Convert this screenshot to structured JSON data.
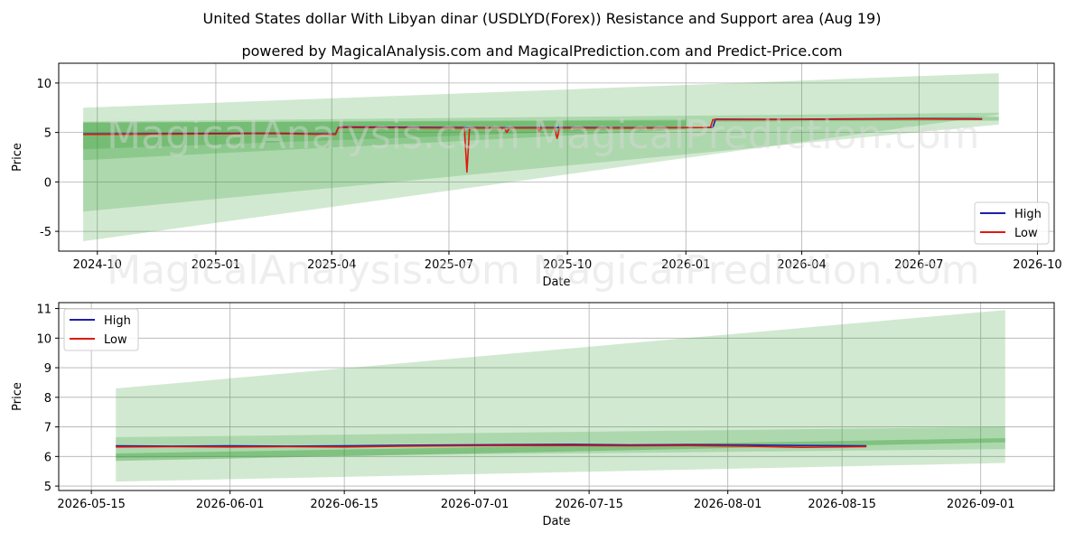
{
  "figure": {
    "title": "United States dollar With Libyan dinar (USDLYD(Forex)) Resistance and Support area (Aug 19)",
    "subtitle": "powered by MagicalAnalysis.com and MagicalPrediction.com and Predict-Price.com",
    "watermarks": [
      "MagicalAnalysis.com",
      "MagicalPrediction.com"
    ],
    "colors": {
      "high": "#1f1fa8",
      "low": "#e0190f",
      "band": "#2e9b2e",
      "grid": "#b0b0b0"
    }
  },
  "chart_data": [
    {
      "type": "line",
      "xlabel": "Date",
      "ylabel": "Price",
      "xlim": [
        "2024-09-01",
        "2026-10-14"
      ],
      "ylim": [
        -7,
        12
      ],
      "xticks": [
        "2024-10",
        "2025-01",
        "2025-04",
        "2025-07",
        "2025-10",
        "2026-01",
        "2026-04",
        "2026-07",
        "2026-10"
      ],
      "xtick_dates": [
        "2024-10-01",
        "2025-01-01",
        "2025-04-01",
        "2025-07-01",
        "2025-10-01",
        "2026-01-01",
        "2026-04-01",
        "2026-07-01",
        "2026-10-01"
      ],
      "yticks": [
        -5,
        0,
        5,
        10
      ],
      "legend": {
        "position": "lower-right",
        "entries": [
          "High",
          "Low"
        ]
      },
      "grid": true,
      "series": [
        {
          "name": "High",
          "x": [
            "2024-09-20",
            "2024-12-01",
            "2025-02-15",
            "2025-03-20",
            "2025-04-04",
            "2025-04-06",
            "2025-04-10",
            "2025-06-01",
            "2025-08-01",
            "2025-10-01",
            "2025-12-01",
            "2026-01-15",
            "2026-01-22",
            "2026-01-24",
            "2026-03-01",
            "2026-05-01",
            "2026-07-01",
            "2026-08-19"
          ],
          "values": [
            4.85,
            4.88,
            4.92,
            4.86,
            4.85,
            5.5,
            5.55,
            5.52,
            5.48,
            5.5,
            5.48,
            5.5,
            5.52,
            6.35,
            6.33,
            6.36,
            6.4,
            6.37
          ]
        },
        {
          "name": "Low",
          "x": [
            "2024-09-20",
            "2024-12-01",
            "2025-02-15",
            "2025-03-20",
            "2025-04-04",
            "2025-04-06",
            "2025-04-10",
            "2025-06-01",
            "2025-07-13",
            "2025-07-15",
            "2025-07-17",
            "2025-08-13",
            "2025-08-15",
            "2025-08-17",
            "2025-09-08",
            "2025-09-09",
            "2025-09-10",
            "2025-09-21",
            "2025-09-23",
            "2025-09-25",
            "2025-12-01",
            "2026-01-20",
            "2026-01-22",
            "2026-03-01",
            "2026-05-01",
            "2026-07-01",
            "2026-08-19"
          ],
          "values": [
            4.8,
            4.84,
            4.88,
            4.82,
            4.8,
            5.45,
            5.5,
            5.47,
            5.45,
            1.0,
            5.45,
            5.45,
            5.0,
            5.45,
            5.45,
            5.05,
            5.45,
            5.45,
            4.4,
            5.45,
            5.45,
            5.5,
            6.3,
            6.3,
            6.33,
            6.36,
            6.33
          ]
        }
      ],
      "bands": [
        {
          "x": [
            "2024-09-20",
            "2026-09-01"
          ],
          "upper": [
            7.5,
            11.0
          ],
          "lower": [
            -6.0,
            6.8
          ],
          "opacity": 0.22
        },
        {
          "x": [
            "2024-09-20",
            "2026-09-01"
          ],
          "upper": [
            6.1,
            7.0
          ],
          "lower": [
            -3.0,
            5.8
          ],
          "opacity": 0.22
        },
        {
          "x": [
            "2024-09-20",
            "2026-01-01"
          ],
          "upper": [
            6.0,
            6.2
          ],
          "lower": [
            2.2,
            5.3
          ],
          "opacity": 0.25
        },
        {
          "x": [
            "2024-09-20",
            "2026-01-01"
          ],
          "upper": [
            6.0,
            6.3
          ],
          "lower": [
            3.3,
            5.5
          ],
          "opacity": 0.25
        },
        {
          "x": [
            "2026-01-22",
            "2026-09-01"
          ],
          "upper": [
            6.3,
            6.6
          ],
          "lower": [
            6.1,
            6.2
          ],
          "opacity": 0.3
        }
      ]
    },
    {
      "type": "line",
      "xlabel": "Date",
      "ylabel": "Price",
      "xlim": [
        "2026-05-11",
        "2026-09-10"
      ],
      "ylim": [
        4.85,
        11.2
      ],
      "xticks": [
        "2026-05-15",
        "2026-06-01",
        "2026-06-15",
        "2026-07-01",
        "2026-07-15",
        "2026-08-01",
        "2026-08-15",
        "2026-09-01"
      ],
      "yticks": [
        5,
        6,
        7,
        8,
        9,
        10,
        11
      ],
      "legend": {
        "position": "upper-left",
        "entries": [
          "High",
          "Low"
        ]
      },
      "grid": true,
      "series": [
        {
          "name": "High",
          "x": [
            "2026-05-18",
            "2026-05-25",
            "2026-06-01",
            "2026-06-08",
            "2026-06-15",
            "2026-06-22",
            "2026-06-29",
            "2026-07-06",
            "2026-07-13",
            "2026-07-20",
            "2026-07-27",
            "2026-08-03",
            "2026-08-10",
            "2026-08-18"
          ],
          "values": [
            6.36,
            6.35,
            6.36,
            6.35,
            6.36,
            6.38,
            6.39,
            6.4,
            6.41,
            6.39,
            6.4,
            6.39,
            6.37,
            6.36
          ]
        },
        {
          "name": "Low",
          "x": [
            "2026-05-18",
            "2026-05-25",
            "2026-06-01",
            "2026-06-08",
            "2026-06-15",
            "2026-06-22",
            "2026-06-29",
            "2026-07-06",
            "2026-07-13",
            "2026-07-20",
            "2026-07-27",
            "2026-08-03",
            "2026-08-10",
            "2026-08-18"
          ],
          "values": [
            6.32,
            6.33,
            6.32,
            6.33,
            6.32,
            6.35,
            6.36,
            6.37,
            6.37,
            6.36,
            6.37,
            6.35,
            6.31,
            6.33
          ]
        }
      ],
      "bands": [
        {
          "x": [
            "2026-05-18",
            "2026-09-04"
          ],
          "upper": [
            8.3,
            10.95
          ],
          "lower": [
            5.15,
            5.78
          ],
          "opacity": 0.22
        },
        {
          "x": [
            "2026-05-18",
            "2026-09-04"
          ],
          "upper": [
            6.65,
            7.0
          ],
          "lower": [
            5.95,
            6.25
          ],
          "opacity": 0.22
        },
        {
          "x": [
            "2026-05-18",
            "2026-09-04"
          ],
          "upper": [
            6.1,
            6.62
          ],
          "lower": [
            5.85,
            6.48
          ],
          "opacity": 0.35
        }
      ]
    }
  ]
}
